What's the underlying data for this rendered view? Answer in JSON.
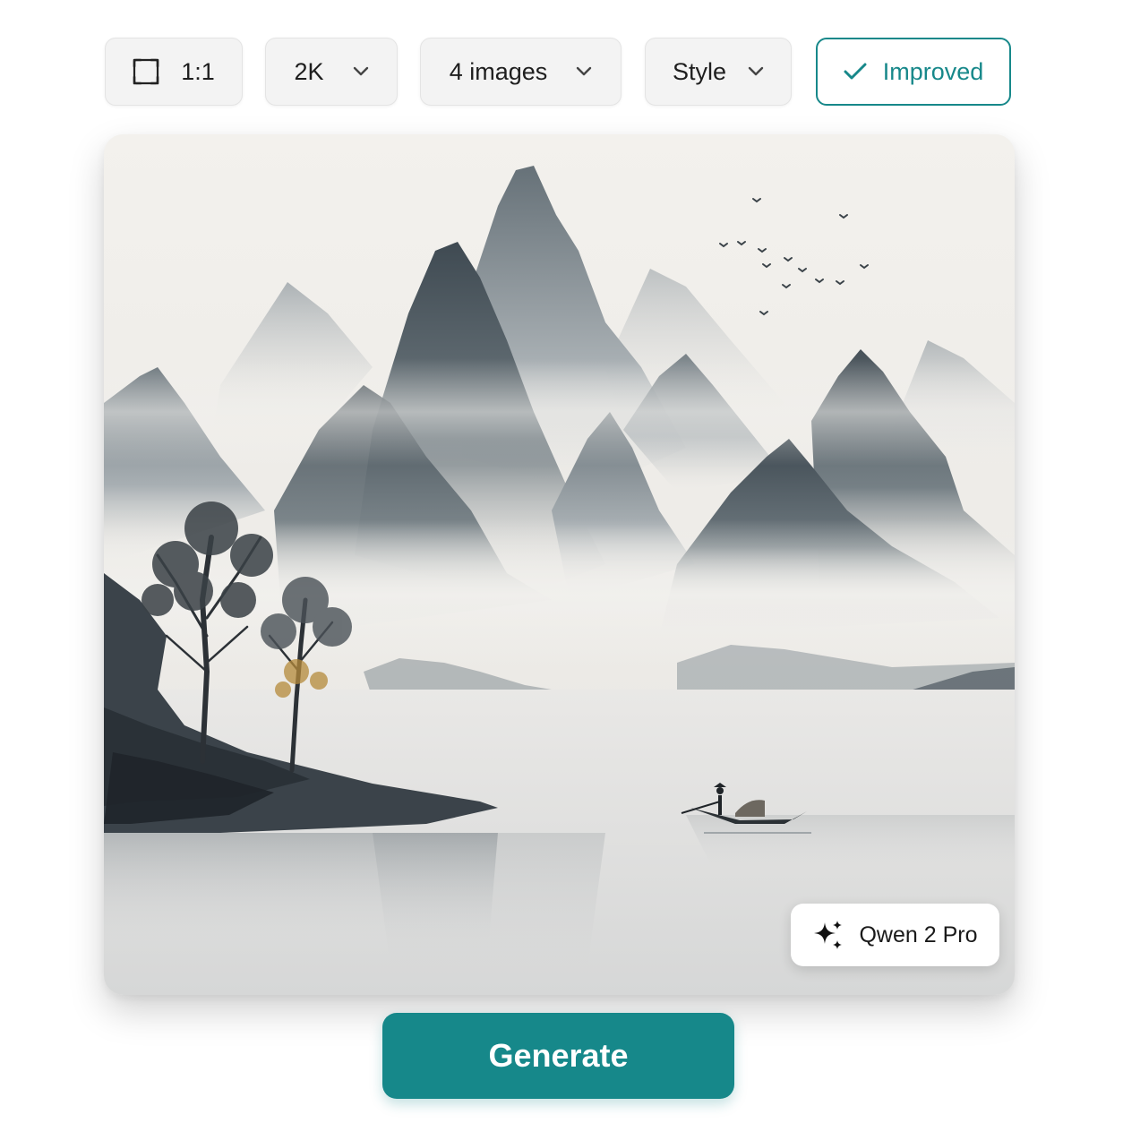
{
  "toolbar": {
    "aspect_ratio": {
      "label": "1:1",
      "icon": "aspect-ratio-icon"
    },
    "resolution": {
      "label": "2K",
      "icon": "chevron-down-icon"
    },
    "image_count": {
      "label": "4 images",
      "icon": "chevron-down-icon"
    },
    "style": {
      "label": "Style",
      "icon": "chevron-down-icon"
    },
    "improved": {
      "label": "Improved",
      "icon": "checkmark-icon",
      "active": true
    }
  },
  "preview": {
    "model_badge": {
      "label": "Qwen 2 Pro",
      "icon": "sparkle-icon"
    }
  },
  "actions": {
    "generate_label": "Generate"
  },
  "colors": {
    "accent": "#16888a",
    "chip_background": "#f3f3f3",
    "page_background": "#ffffff"
  }
}
